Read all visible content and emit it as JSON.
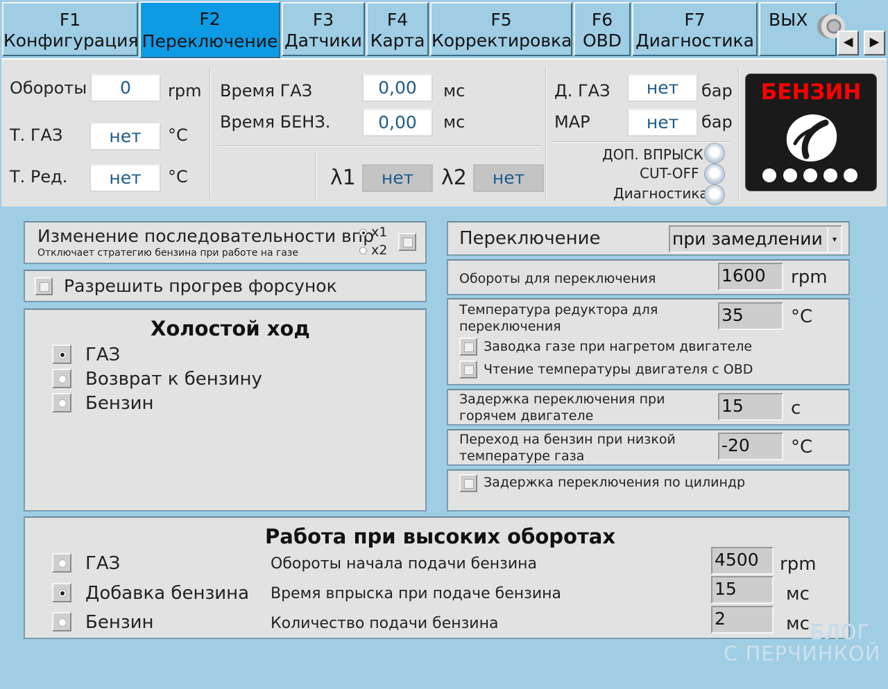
{
  "tabs": [
    {
      "key": "F1",
      "label": "Конфигурация"
    },
    {
      "key": "F2",
      "label": "Переключение"
    },
    {
      "key": "F3",
      "label": "Датчики"
    },
    {
      "key": "F4",
      "label": "Карта"
    },
    {
      "key": "F5",
      "label": "Корректировка"
    },
    {
      "key": "F6",
      "label": "OBD"
    },
    {
      "key": "F7",
      "label": "Диагностика"
    },
    {
      "key": "ВЫХ",
      "label": ""
    }
  ],
  "tab_scroll": {
    "left": "◀",
    "right": "▶"
  },
  "status": {
    "rpm_label": "Обороты",
    "rpm_value": "0",
    "rpm_unit": "rpm",
    "tgas_label": "Т. ГАЗ",
    "tgas_value": "нет",
    "tgas_unit": "°C",
    "tred_label": "Т. Ред.",
    "tred_value": "нет",
    "tred_unit": "°C",
    "time_gas_label": "Время ГАЗ",
    "time_gas_value": "0,00",
    "time_gas_unit": "мс",
    "time_benz_label": "Время БЕНЗ.",
    "time_benz_value": "0,00",
    "time_benz_unit": "мс",
    "lambda1_label": "λ1",
    "lambda1_value": "нет",
    "lambda2_label": "λ2",
    "lambda2_value": "нет",
    "dgas_label": "Д. ГАЗ",
    "dgas_value": "нет",
    "dgas_unit": "бар",
    "map_label": "MAP",
    "map_value": "нет",
    "map_unit": "бар",
    "ind_extra_injection": "ДОП. ВПРЫСК",
    "ind_cutoff": "CUT-OFF",
    "ind_diagnostics": "Диагностика",
    "fuel_mode": "БЕНЗИН"
  },
  "sequence": {
    "title": "Изменение последовательности впр",
    "subtitle": "Отключает стратегию бензина при работе на газе",
    "x1": "x1",
    "x2": "x2",
    "selected": "x1"
  },
  "injector_heating": {
    "label": "Разрешить прогрев форсунок"
  },
  "idle": {
    "title": "Холостой ход",
    "options": [
      "ГАЗ",
      "Возврат к бензину",
      "Бензин"
    ],
    "selected": 0
  },
  "switching": {
    "label": "Переключение",
    "value": "при замедлении",
    "rpm_label": "Обороты для переключения",
    "rpm_value": "1600",
    "rpm_unit": "rpm",
    "temp_label_1": "Температура редуктора для",
    "temp_label_2": "переключения",
    "temp_value": "35",
    "temp_unit": "°C",
    "warm_start_label": "Заводка газе при нагретом двигателе",
    "obd_temp_label": "Чтение температуры двигателя с OBD",
    "delay_label_1": "Задержка переключения при",
    "delay_label_2": "горячем двигателе",
    "delay_value": "15",
    "delay_unit": "с",
    "low_temp_label_1": "Переход на бензин при низкой",
    "low_temp_label_2": "температуре газа",
    "low_temp_value": "-20",
    "low_temp_unit": "°C",
    "cyl_delay_label": "Задержка переключения по цилиндр"
  },
  "high_rpm": {
    "title": "Работа при высоких оборотах",
    "options": [
      "ГАЗ",
      "Добавка бензина",
      "Бензин"
    ],
    "selected": 1,
    "start_rpm_label": "Обороты начала подачи бензина",
    "start_rpm_value": "4500",
    "start_rpm_unit": "rpm",
    "inj_time_label": "Время впрыска при подаче бензина",
    "inj_time_value": "15",
    "inj_time_unit": "мс",
    "amount_label": "Количество подачи бензина",
    "amount_value": "2",
    "amount_unit": "мс"
  },
  "watermark": {
    "line1": "БЛОГ",
    "line2": "С ПЕРЧИНКОЙ"
  }
}
